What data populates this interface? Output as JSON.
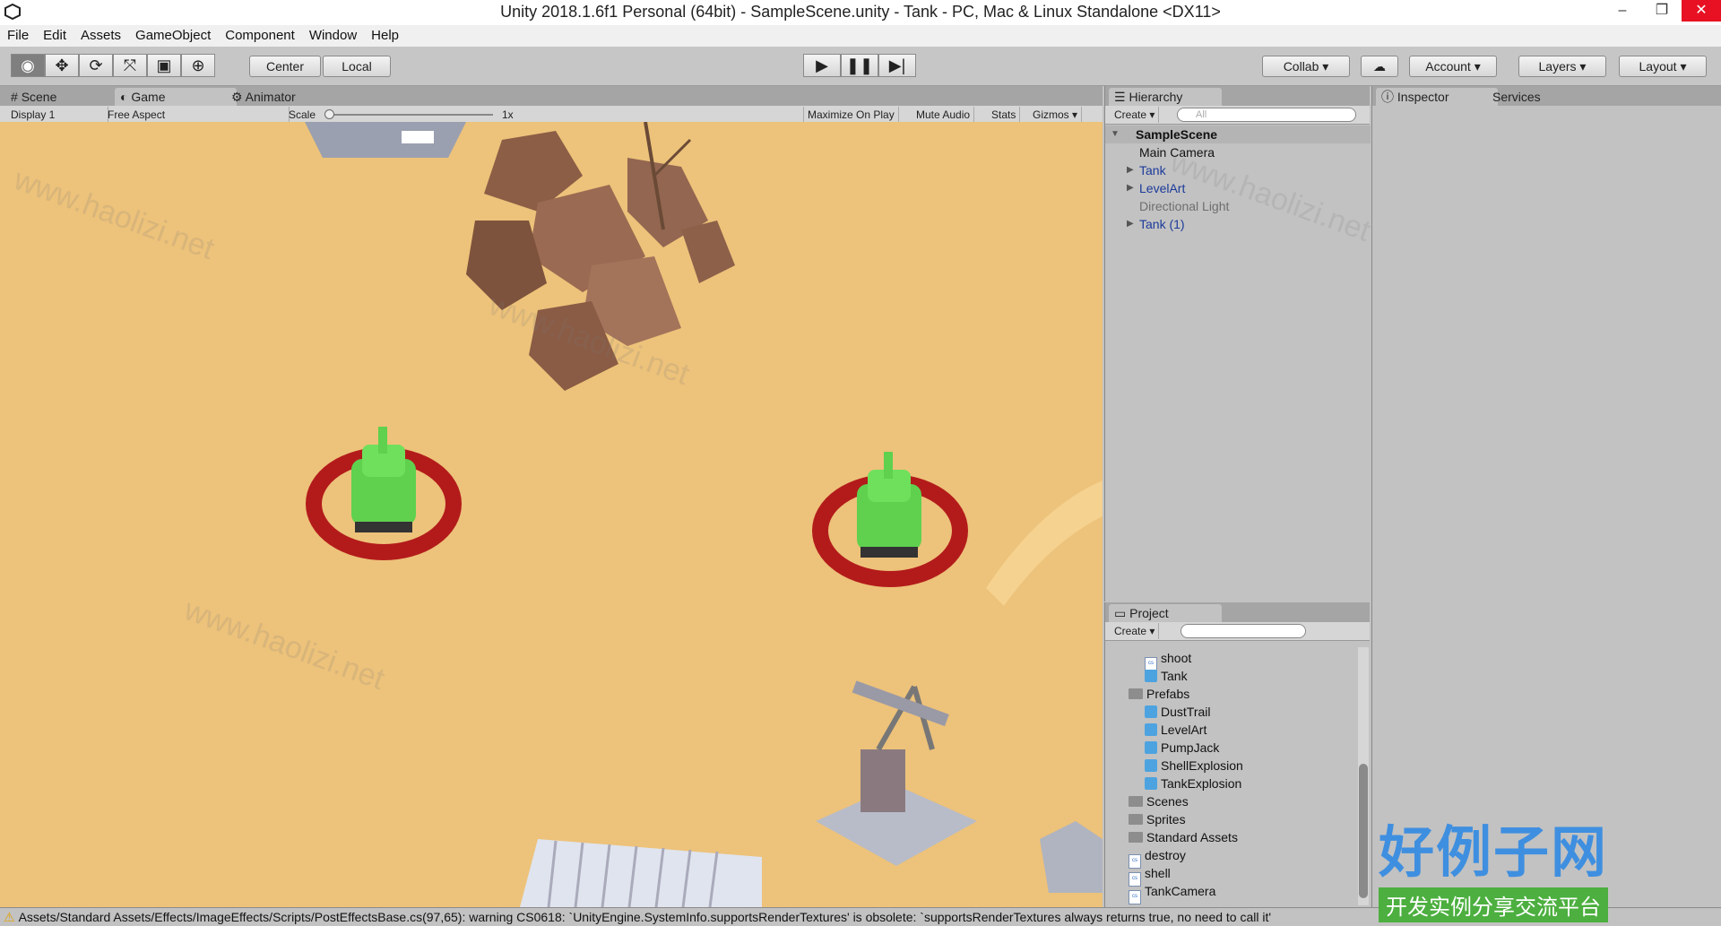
{
  "window": {
    "title": "Unity 2018.1.6f1 Personal (64bit) - SampleScene.unity - Tank - PC, Mac & Linux Standalone <DX11>",
    "minimize": "–",
    "maximize": "❐",
    "close": "✕"
  },
  "menu": [
    "File",
    "Edit",
    "Assets",
    "GameObject",
    "Component",
    "Window",
    "Help"
  ],
  "toolbar": {
    "tools": [
      "eye-icon",
      "move-icon",
      "rotate-icon",
      "scale-icon",
      "rect-icon",
      "transform-icon"
    ],
    "pivot": "Center",
    "space": "Local",
    "collab": "Collab",
    "account": "Account",
    "layers": "Layers",
    "layout": "Layout"
  },
  "view_tabs": [
    "Scene",
    "Game",
    "Animator"
  ],
  "game_bar": {
    "display": "Display 1",
    "aspect": "Free Aspect",
    "scale_label": "Scale",
    "scale_value": "1x",
    "maximize": "Maximize On Play",
    "mute": "Mute Audio",
    "stats": "Stats",
    "gizmos": "Gizmos"
  },
  "hierarchy": {
    "tab": "Hierarchy",
    "create": "Create",
    "search_placeholder": "All",
    "scene": "SampleScene",
    "items": [
      "Main Camera",
      "Tank",
      "LevelArt",
      "Directional Light",
      "Tank (1)"
    ]
  },
  "inspector": {
    "tab": "Inspector",
    "services": "Services"
  },
  "project": {
    "tab": "Project",
    "create": "Create",
    "items": [
      "shoot",
      "Tank",
      "Prefabs",
      "DustTrail",
      "LevelArt",
      "PumpJack",
      "ShellExplosion",
      "TankExplosion",
      "Scenes",
      "Sprites",
      "Standard Assets",
      "destroy",
      "shell",
      "TankCamera"
    ]
  },
  "status": {
    "message": "Assets/Standard Assets/Effects/ImageEffects/Scripts/PostEffectsBase.cs(97,65): warning CS0618: `UnityEngine.SystemInfo.supportsRenderTextures' is obsolete: `supportsRenderTextures always returns true, no need to call it'"
  },
  "watermark": {
    "big": "好例子网",
    "small": "开发实例分享交流平台",
    "repeat": "www.haolizi.net"
  },
  "colors": {
    "sand": "#edc27a",
    "tank": "#5fd14f",
    "ring": "#b31b1b",
    "prefab_blue": "#1b3a9a"
  }
}
